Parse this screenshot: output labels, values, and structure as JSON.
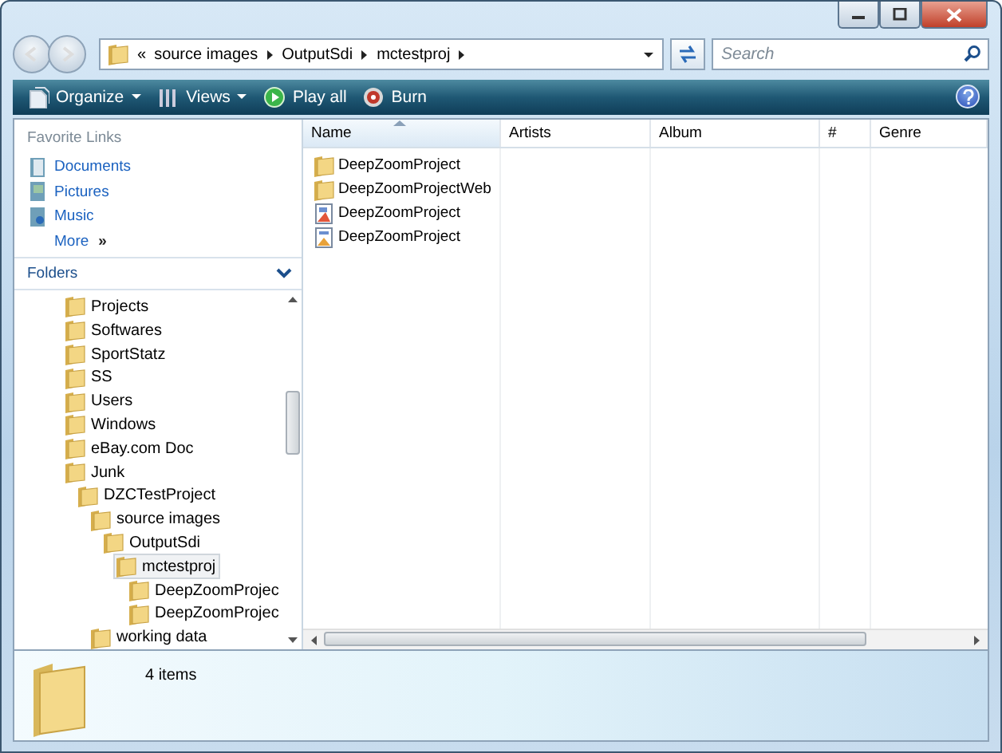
{
  "address_bar": {
    "overflow_marker": "«",
    "crumbs": [
      "source images",
      "OutputSdi",
      "mctestproj"
    ]
  },
  "search": {
    "placeholder": "Search"
  },
  "toolbar": [
    {
      "label": "Organize",
      "kind": "organize"
    },
    {
      "label": "Views",
      "kind": "views"
    },
    {
      "label": "Play all",
      "kind": "play"
    },
    {
      "label": "Burn",
      "kind": "burn"
    }
  ],
  "favorite_links": {
    "title": "Favorite Links",
    "items": [
      {
        "label": "Documents",
        "kind": "documents"
      },
      {
        "label": "Pictures",
        "kind": "pictures"
      },
      {
        "label": "Music",
        "kind": "music"
      }
    ],
    "more": {
      "label": "More",
      "marker": "»"
    }
  },
  "folders": {
    "title": "Folders",
    "tree": [
      {
        "label": "Projects",
        "selected": false
      },
      {
        "label": "Softwares",
        "selected": false
      },
      {
        "label": "SportStatz",
        "selected": false
      },
      {
        "label": "SS",
        "selected": false
      },
      {
        "label": "Users",
        "selected": false
      },
      {
        "label": "Windows",
        "selected": false
      },
      {
        "label": "eBay.com Doc",
        "selected": false
      },
      {
        "label": "Junk",
        "selected": false,
        "children": [
          {
            "label": "DZCTestProject",
            "selected": false,
            "children": [
              {
                "label": "source images",
                "selected": false,
                "children": [
                  {
                    "label": "OutputSdi",
                    "selected": false,
                    "children": [
                      {
                        "label": "mctestproj",
                        "selected": true,
                        "children": [
                          {
                            "label": "DeepZoomProjec",
                            "selected": false
                          },
                          {
                            "label": "DeepZoomProjec",
                            "selected": false
                          }
                        ]
                      }
                    ]
                  }
                ]
              },
              {
                "label": "working data",
                "selected": false
              }
            ]
          }
        ]
      }
    ]
  },
  "file_list": {
    "columns": [
      {
        "label": "Name",
        "sorted": true
      },
      {
        "label": "Artists",
        "sorted": false
      },
      {
        "label": "Album",
        "sorted": false
      },
      {
        "label": "#",
        "sorted": false
      },
      {
        "label": "Genre",
        "sorted": false
      }
    ],
    "rows": [
      {
        "name": "DeepZoomProject",
        "kind": "folder"
      },
      {
        "name": "DeepZoomProjectWeb",
        "kind": "folder"
      },
      {
        "name": "DeepZoomProject",
        "kind": "solution"
      },
      {
        "name": "DeepZoomProject",
        "kind": "project"
      }
    ]
  },
  "details": {
    "summary": "4 items"
  }
}
